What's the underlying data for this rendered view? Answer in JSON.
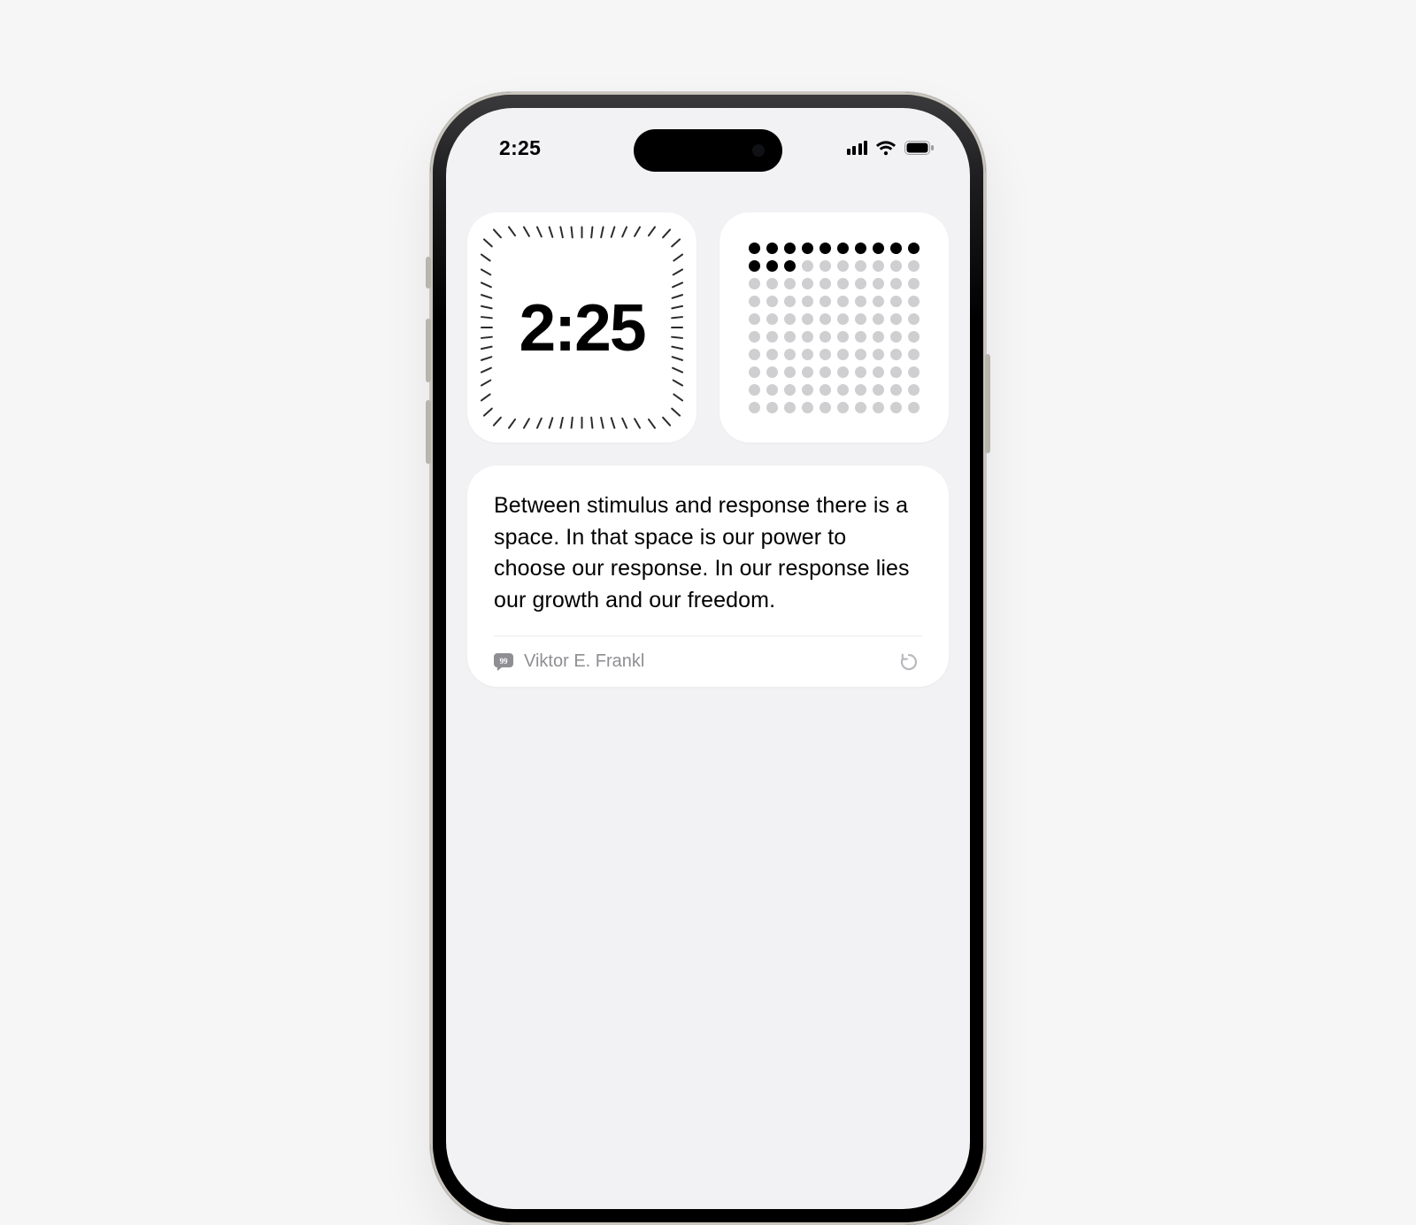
{
  "status_bar": {
    "time": "2:25",
    "cellular_bars": 4,
    "wifi_strength": 3,
    "battery_level": 95
  },
  "widgets": {
    "clock": {
      "time": "2:25"
    },
    "dots": {
      "cols": 10,
      "rows": 10,
      "filled": 13
    },
    "quote": {
      "text": "Between stimulus and response there is a space. In that space is our power to choose our response. In our response lies our growth and our freedom.",
      "author": "Viktor E. Frankl",
      "icon": "quote-bubble-icon",
      "refresh_icon": "refresh-icon"
    }
  }
}
